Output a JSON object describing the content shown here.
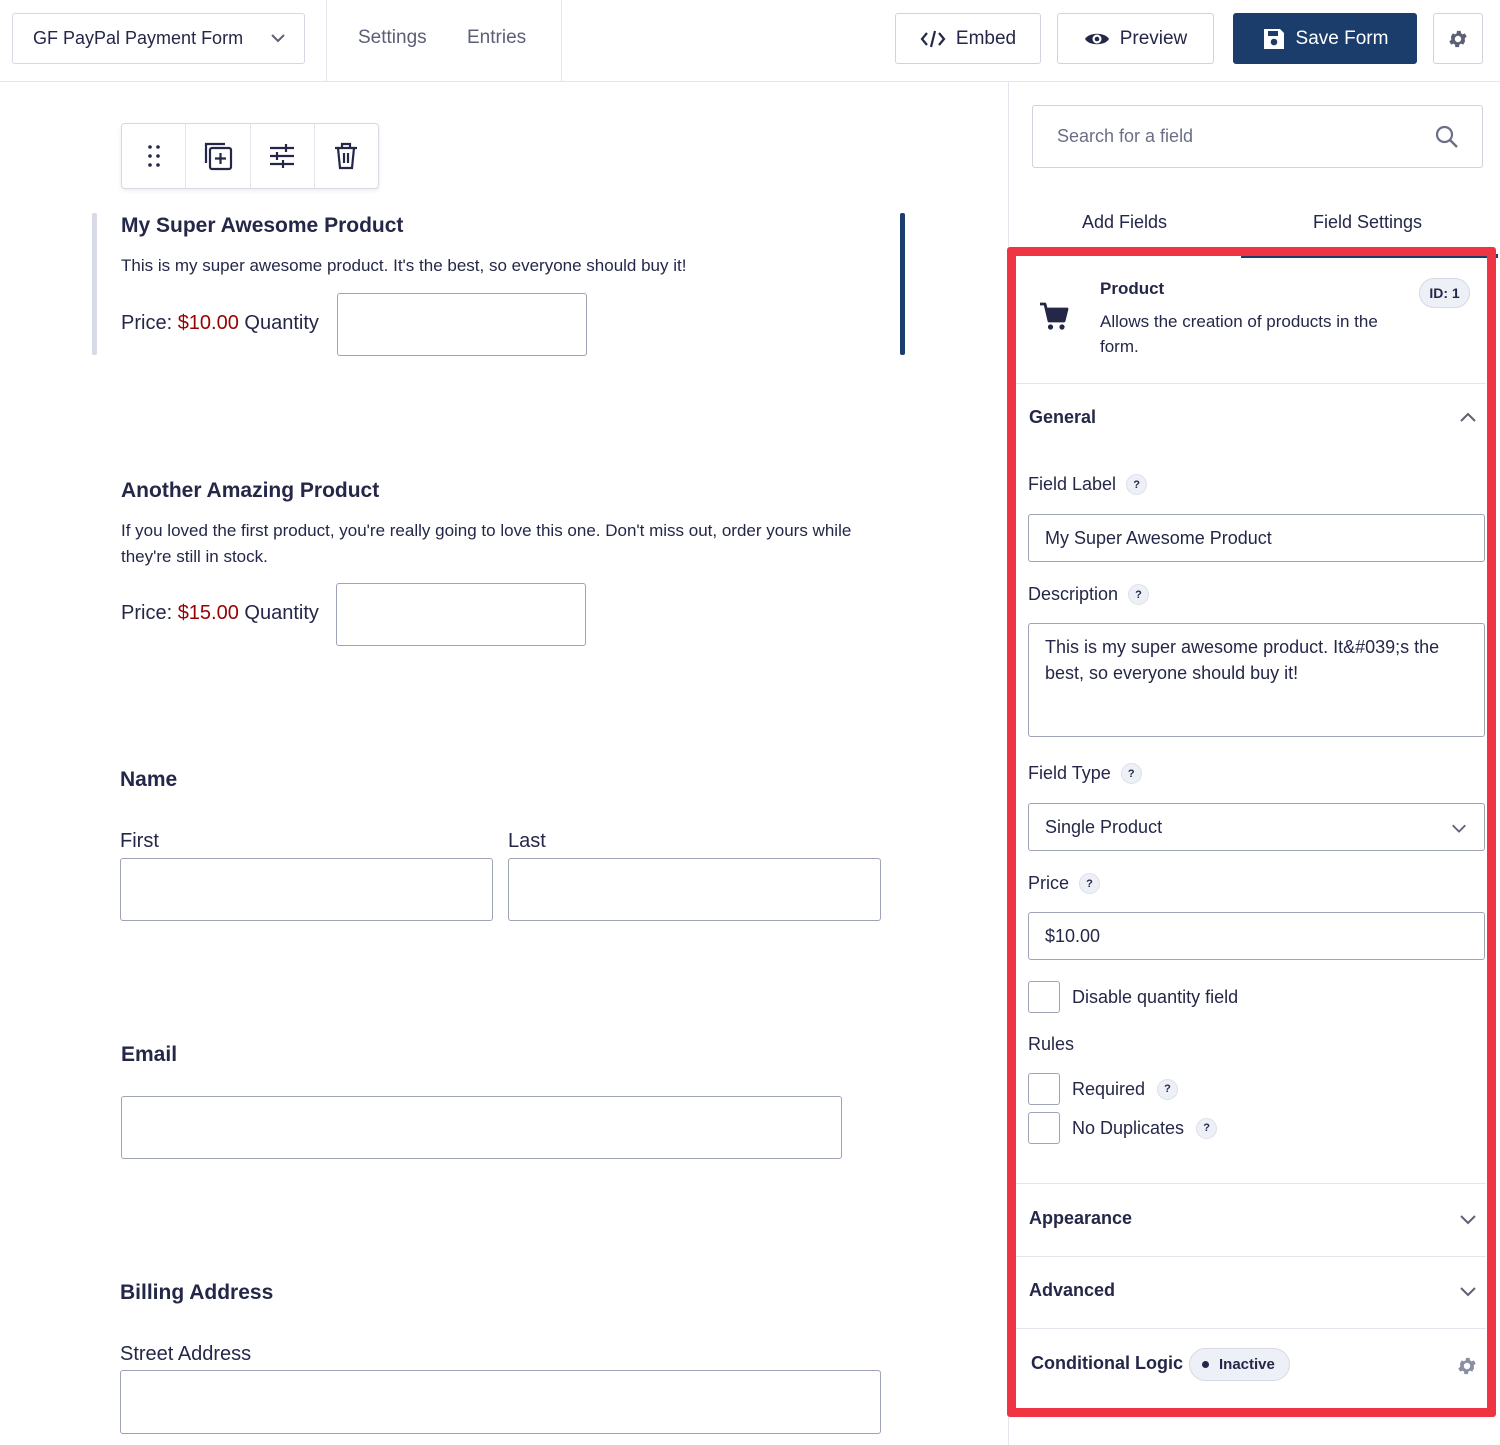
{
  "header": {
    "form_name": "GF PayPal Payment Form",
    "nav": {
      "settings": "Settings",
      "entries": "Entries"
    },
    "embed_label": "Embed",
    "preview_label": "Preview",
    "save_label": "Save Form"
  },
  "canvas": {
    "product1": {
      "title": "My Super Awesome Product",
      "description": "This is my super awesome product. It's the best, so everyone should buy it!",
      "price_prefix": "Price:",
      "price": "$10.00",
      "quantity_label": "Quantity"
    },
    "product2": {
      "title": "Another Amazing Product",
      "description": "If you loved the first product, you're really going to love this one. Don't miss out, order yours while they're still in stock.",
      "price_prefix": "Price:",
      "price": "$15.00",
      "quantity_label": "Quantity"
    },
    "name_field": {
      "title": "Name",
      "first": "First",
      "last": "Last"
    },
    "email_field": {
      "title": "Email"
    },
    "address_field": {
      "title": "Billing Address",
      "street": "Street Address"
    }
  },
  "sidebar": {
    "search_placeholder": "Search for a field",
    "tabs": {
      "add_fields": "Add Fields",
      "field_settings": "Field Settings"
    },
    "field_info": {
      "name": "Product",
      "description": "Allows the creation of products in the form.",
      "id_badge": "ID: 1"
    },
    "general": {
      "title": "General",
      "field_label": "Field Label",
      "field_label_value": "My Super Awesome Product",
      "description_label": "Description",
      "description_value": "This is my super awesome product. It&#039;s the best, so everyone should buy it!",
      "field_type_label": "Field Type",
      "field_type_value": "Single Product",
      "price_label": "Price",
      "price_value": "$10.00",
      "disable_quantity": "Disable quantity field",
      "rules_label": "Rules",
      "required": "Required",
      "no_duplicates": "No Duplicates",
      "help_mark": "?"
    },
    "appearance_title": "Appearance",
    "advanced_title": "Advanced",
    "conditional_logic": {
      "title": "Conditional Logic",
      "status": "Inactive"
    }
  },
  "colors": {
    "primary": "#1b3d6b",
    "highlight_border": "#ef3444",
    "price": "#990000"
  }
}
